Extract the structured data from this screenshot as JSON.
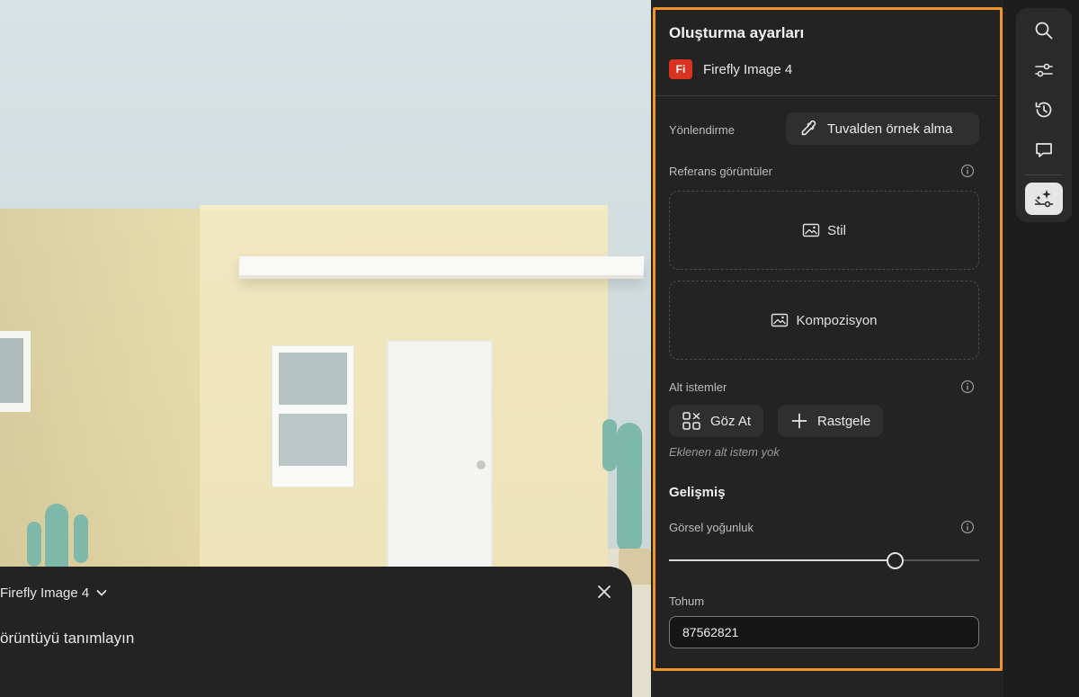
{
  "prompt_panel": {
    "model_label": "Firefly Image 4",
    "prompt_text": "örüntüyü tanımlayın"
  },
  "settings": {
    "title": "Oluşturma ayarları",
    "model_badge": "Fi",
    "model_label": "Firefly Image 4",
    "guidance_label": "Yönlendirme",
    "sample_button": "Tuvalden örnek alma",
    "reference_label": "Referans görüntüler",
    "style_dropzone": "Stil",
    "composition_dropzone": "Kompozisyon",
    "subprompts_label": "Alt istemler",
    "browse_button": "Göz At",
    "random_button": "Rastgele",
    "no_subprompts": "Eklenen alt istem yok",
    "advanced_section": "Gelişmiş",
    "visual_intensity_label": "Görsel yoğunluk",
    "visual_intensity_value": 0.73,
    "seed_label": "Tohum",
    "seed_value": "87562821"
  },
  "toolbar": {
    "items": [
      "search-icon",
      "sliders-icon",
      "history-icon",
      "comment-icon",
      "generate-settings-icon"
    ],
    "active": "generate-settings-icon"
  },
  "colors": {
    "panel_bg": "#232323",
    "highlight_outline": "#f0952a",
    "firefly_badge": "#d9321f"
  }
}
